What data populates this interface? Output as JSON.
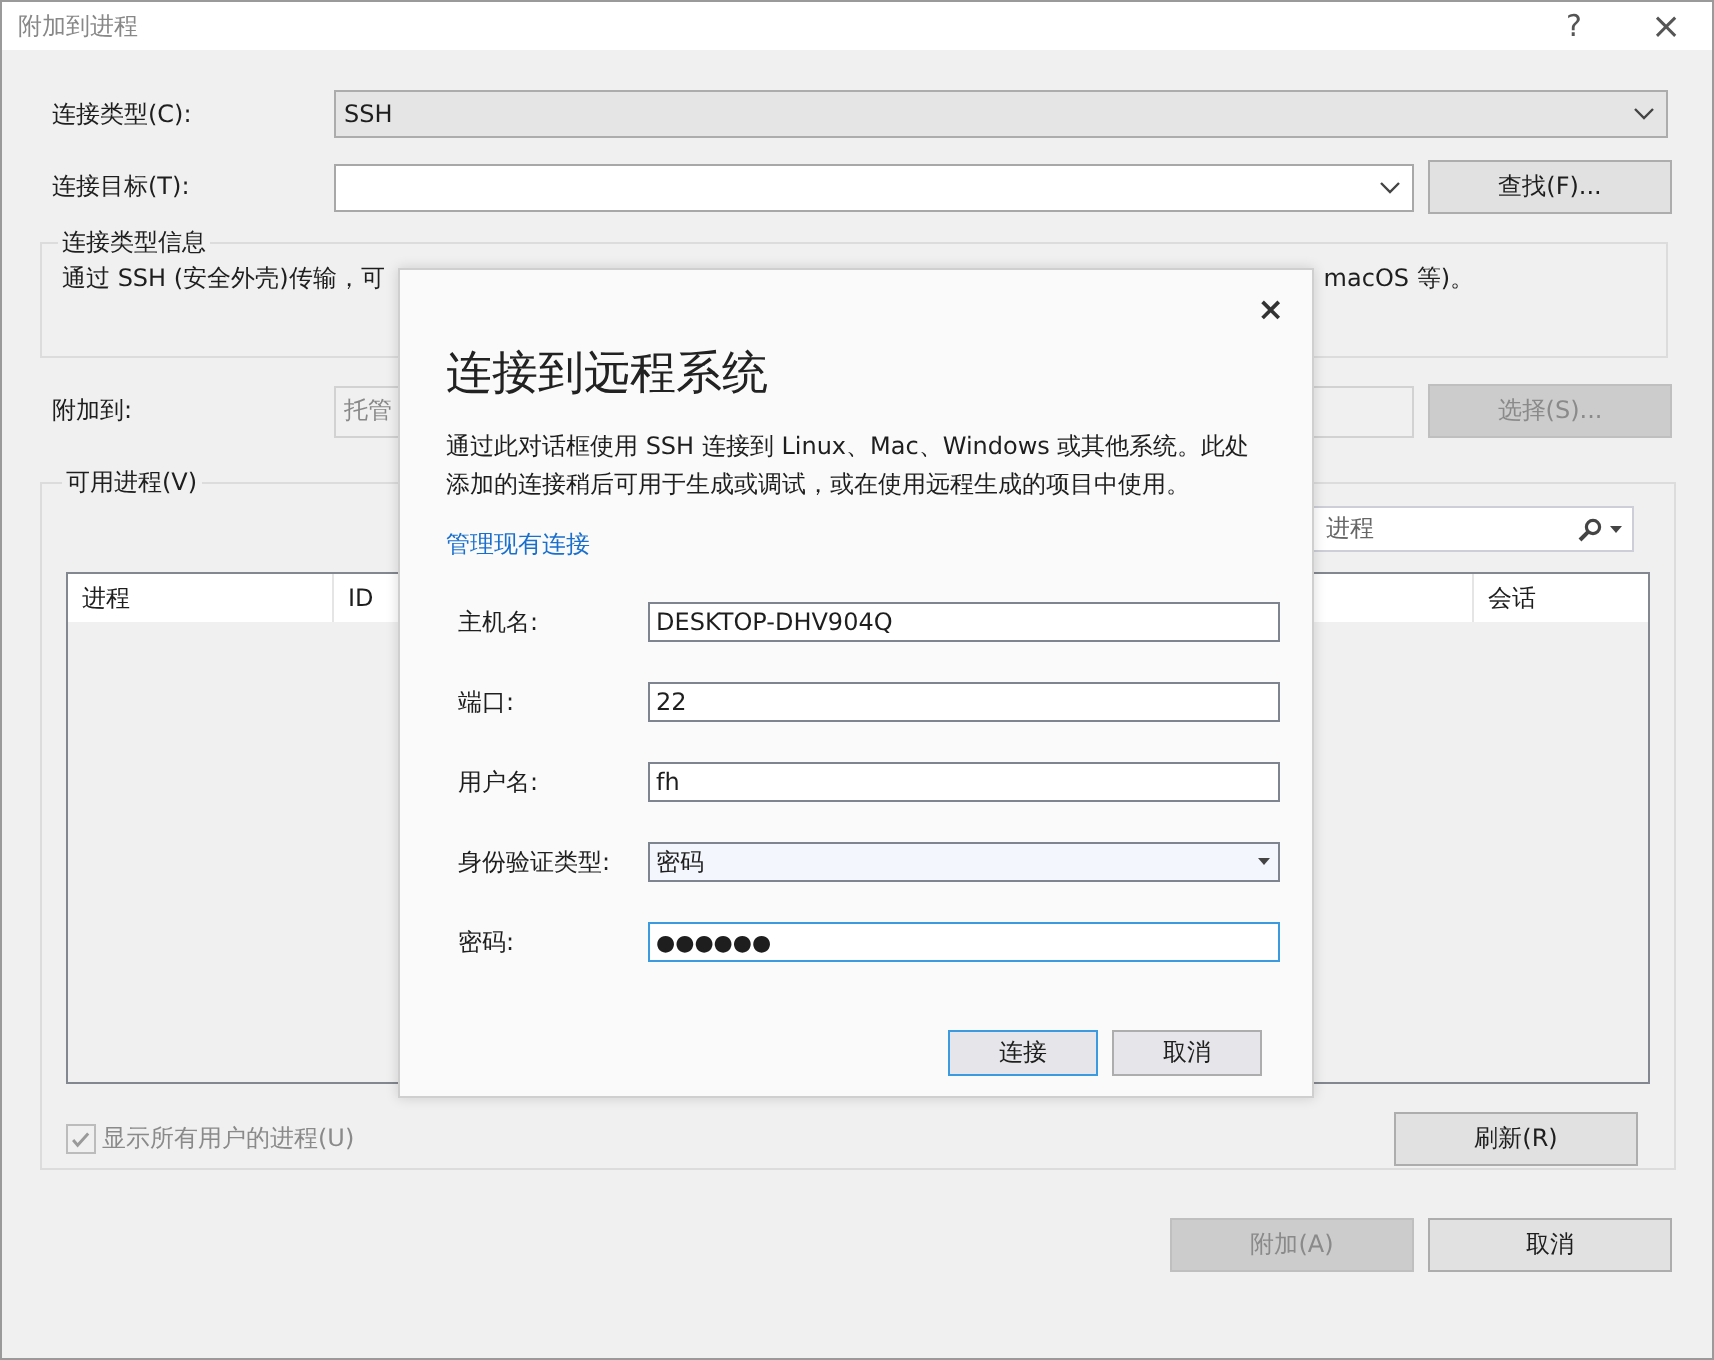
{
  "window": {
    "title": "附加到进程",
    "help": "?",
    "close": "×"
  },
  "connection_type": {
    "label": "连接类型(C):",
    "value": "SSH"
  },
  "connection_target": {
    "label": "连接目标(T):",
    "button": "查找(F)..."
  },
  "info_group": {
    "title": "连接类型信息",
    "text_start": "通过 SSH (安全外壳)传输，可",
    "text_end": "macOS 等)。"
  },
  "attach_to": {
    "label": "附加到:",
    "value": "托管",
    "button": {
      "label": "选择(S)...",
      "disabled": true
    }
  },
  "processes": {
    "title": "可用进程(V)",
    "search_text": "进程",
    "columns": [
      {
        "label": "进程"
      },
      {
        "label": "ID"
      },
      {
        "label": "会话"
      }
    ],
    "show_all_users": {
      "label": "显示所有用户的进程(U)",
      "checked": true,
      "disabled": true
    },
    "refresh_button": "刷新(R)"
  },
  "buttons": [
    {
      "label": "附加(A)",
      "disabled": true
    },
    {
      "label": "取消",
      "disabled": false
    }
  ],
  "dialog": {
    "title": "连接到远程系统",
    "close": "×",
    "description": "通过此对话框使用 SSH 连接到 Linux、Mac、Windows 或其他系统。此处添加的连接稍后可用于生成或调试，或在使用远程生成的项目中使用。",
    "link": "管理现有连接",
    "fields": [
      {
        "kind": "text",
        "label": "主机名:",
        "value": "DESKTOP-DHV904Q",
        "focused": false
      },
      {
        "kind": "text",
        "label": "端口:",
        "value": "22",
        "focused": false
      },
      {
        "kind": "text",
        "label": "用户名:",
        "value": "fh",
        "focused": false
      },
      {
        "kind": "select",
        "label": "身份验证类型:",
        "value": "密码",
        "focused": false
      },
      {
        "kind": "password",
        "label": "密码:",
        "value": "●●●●●●",
        "focused": true
      }
    ],
    "buttons": [
      {
        "label": "连接",
        "default": true
      },
      {
        "label": "取消",
        "default": false
      }
    ]
  }
}
